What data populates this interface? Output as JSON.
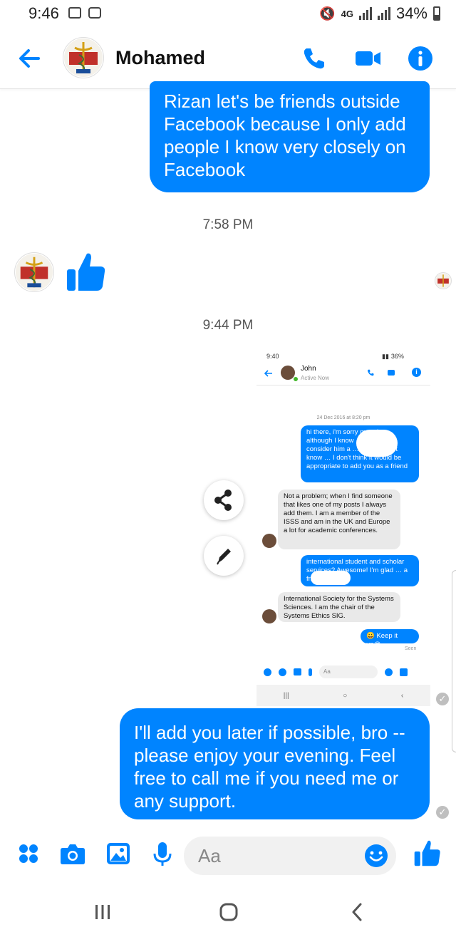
{
  "status_bar": {
    "time": "9:46",
    "network": "4G",
    "battery": "34%"
  },
  "header": {
    "contact_name": "Mohamed"
  },
  "messages": {
    "msg1": "Rizan let's be friends outside Facebook because I only add people I know very closely on Facebook",
    "ts1": "7:58 PM",
    "ts2": "9:44 PM",
    "msg3": "I'll add you later if possible, bro -- please enjoy your evening. Feel free to call me if you need me or any support."
  },
  "embedded": {
    "time": "9:40",
    "battery": "36%",
    "name": "John",
    "status": "Active Now",
    "date": "24 Dec 2016 at 8:20 pm",
    "m1": "hi there, i'm sorry mate but although I know … d really consider him a … d, I don't yet know … I don't think it would be appropriate to add you as a friend",
    "m2": "Not a problem; when I find someone that likes one of my posts I always add them. I am a member of the ISSS and am in the UK and Europe a lot for academic conferences.",
    "m3": "international student and scholar services? Awesome! I'm glad … a friend in you",
    "m4": "International Society for the Systems Sciences. I am the chair of the Systems Ethics SIG.",
    "m5": "😀 Keep it up@",
    "seen": "Seen",
    "input_placeholder": "Aa"
  },
  "composer": {
    "placeholder": "Aa"
  },
  "colors": {
    "accent": "#0084ff"
  }
}
